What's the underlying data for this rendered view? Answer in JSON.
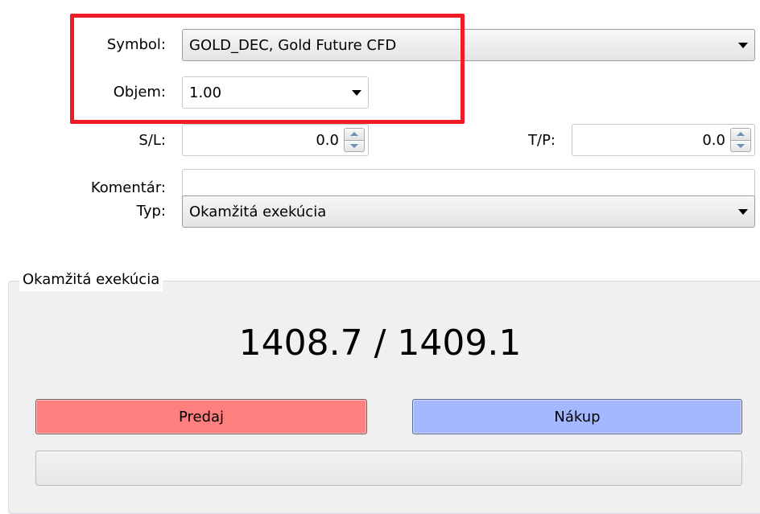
{
  "form": {
    "symbol_label": "Symbol:",
    "symbol_value": "GOLD_DEC, Gold Future CFD",
    "volume_label": "Objem:",
    "volume_value": "1.00",
    "sl_label": "S/L:",
    "sl_value": "0.0",
    "tp_label": "T/P:",
    "tp_value": "0.0",
    "comment_label": "Komentár:",
    "comment_value": "",
    "type_label": "Typ:",
    "type_value": "Okamžitá exekúcia"
  },
  "execution": {
    "group_title": "Okamžitá exekúcia",
    "prices": "1408.7 / 1409.1",
    "sell_label": "Predaj",
    "buy_label": "Nákup"
  },
  "colors": {
    "highlight": "#ee1c24",
    "sell": "#ff7f7f",
    "buy": "#a4b8ff"
  },
  "icons": {
    "dropdown": "chevron-down-icon",
    "spin_up": "spin-up-icon",
    "spin_down": "spin-down-icon"
  }
}
